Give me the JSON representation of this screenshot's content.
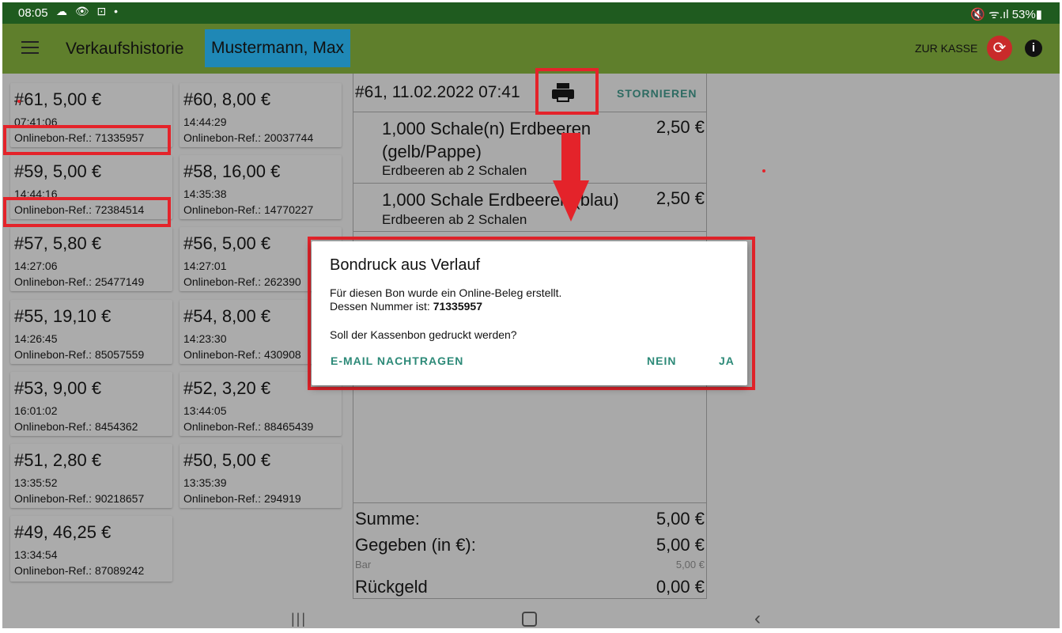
{
  "status_bar": {
    "time": "08:05",
    "icons": "☁ 👁 ⊡ •",
    "right": "🔇 ᯤ.ıl 53%▮"
  },
  "app_bar": {
    "title": "Verkaufshistorie",
    "user": "Mustermann, Max",
    "to_register": "ZUR KASSE",
    "info": "i"
  },
  "receipts": [
    {
      "amount": "#61, 5,00 €",
      "time": "07:41:06",
      "ref": "Onlinebon-Ref.: 71335957"
    },
    {
      "amount": "#60, 8,00 €",
      "time": "14:44:29",
      "ref": "Onlinebon-Ref.: 20037744"
    },
    {
      "amount": "#59, 5,00 €",
      "time": "14:44:16",
      "ref": "Onlinebon-Ref.: 72384514"
    },
    {
      "amount": "#58, 16,00 €",
      "time": "14:35:38",
      "ref": "Onlinebon-Ref.: 14770227"
    },
    {
      "amount": "#57, 5,80 €",
      "time": "14:27:06",
      "ref": "Onlinebon-Ref.: 25477149"
    },
    {
      "amount": "#56, 5,00 €",
      "time": "14:27:01",
      "ref": "Onlinebon-Ref.: 262390"
    },
    {
      "amount": "#55, 19,10 €",
      "time": "14:26:45",
      "ref": "Onlinebon-Ref.: 85057559"
    },
    {
      "amount": "#54, 8,00 €",
      "time": "14:23:30",
      "ref": "Onlinebon-Ref.: 430908"
    },
    {
      "amount": "#53, 9,00 €",
      "time": "16:01:02",
      "ref": "Onlinebon-Ref.: 8454362"
    },
    {
      "amount": "#52, 3,20 €",
      "time": "13:44:05",
      "ref": "Onlinebon-Ref.: 88465439"
    },
    {
      "amount": "#51, 2,80 €",
      "time": "13:35:52",
      "ref": "Onlinebon-Ref.: 90218657"
    },
    {
      "amount": "#50, 5,00 €",
      "time": "13:35:39",
      "ref": "Onlinebon-Ref.: 294919"
    },
    {
      "amount": "#49, 46,25 €",
      "time": "13:34:54",
      "ref": "Onlinebon-Ref.: 87089242"
    }
  ],
  "detail": {
    "title": "#61, 11.02.2022 07:41",
    "cancel": "STORNIEREN",
    "items": [
      {
        "desc": "1,000 Schale(n) Erdbeeren (gelb/Pappe)",
        "price": "2,50 €",
        "sub": "Erdbeeren ab 2 Schalen"
      },
      {
        "desc": "1,000 Schale Erdbeeren (blau)",
        "price": "2,50 €",
        "sub": "Erdbeeren ab 2 Schalen"
      }
    ],
    "sum_label": "Summe:",
    "sum_value": "5,00 €",
    "given_label": "Gegeben (in €):",
    "given_value": "5,00 €",
    "cash_label": "Bar",
    "cash_value": "5,00 €",
    "change_label": "Rückgeld",
    "change_value": "0,00 €"
  },
  "dialog": {
    "title": "Bondruck aus Verlauf",
    "line1": "Für diesen Bon wurde ein Online-Beleg erstellt.",
    "line2_prefix": "Dessen Nummer ist: ",
    "number": "71335957",
    "question": "Soll der Kassenbon gedruckt werden?",
    "btn_email": "E-MAIL NACHTRAGEN",
    "btn_no": "NEIN",
    "btn_yes": "JA"
  },
  "nav": {
    "recent": "|||",
    "back": "‹"
  },
  "colors": {
    "app_bar": "#5f7f2c",
    "status_bar": "#1f5b1f",
    "user_chip": "#1f88b6",
    "accent": "#2d8a78",
    "highlight": "#e4232a"
  }
}
